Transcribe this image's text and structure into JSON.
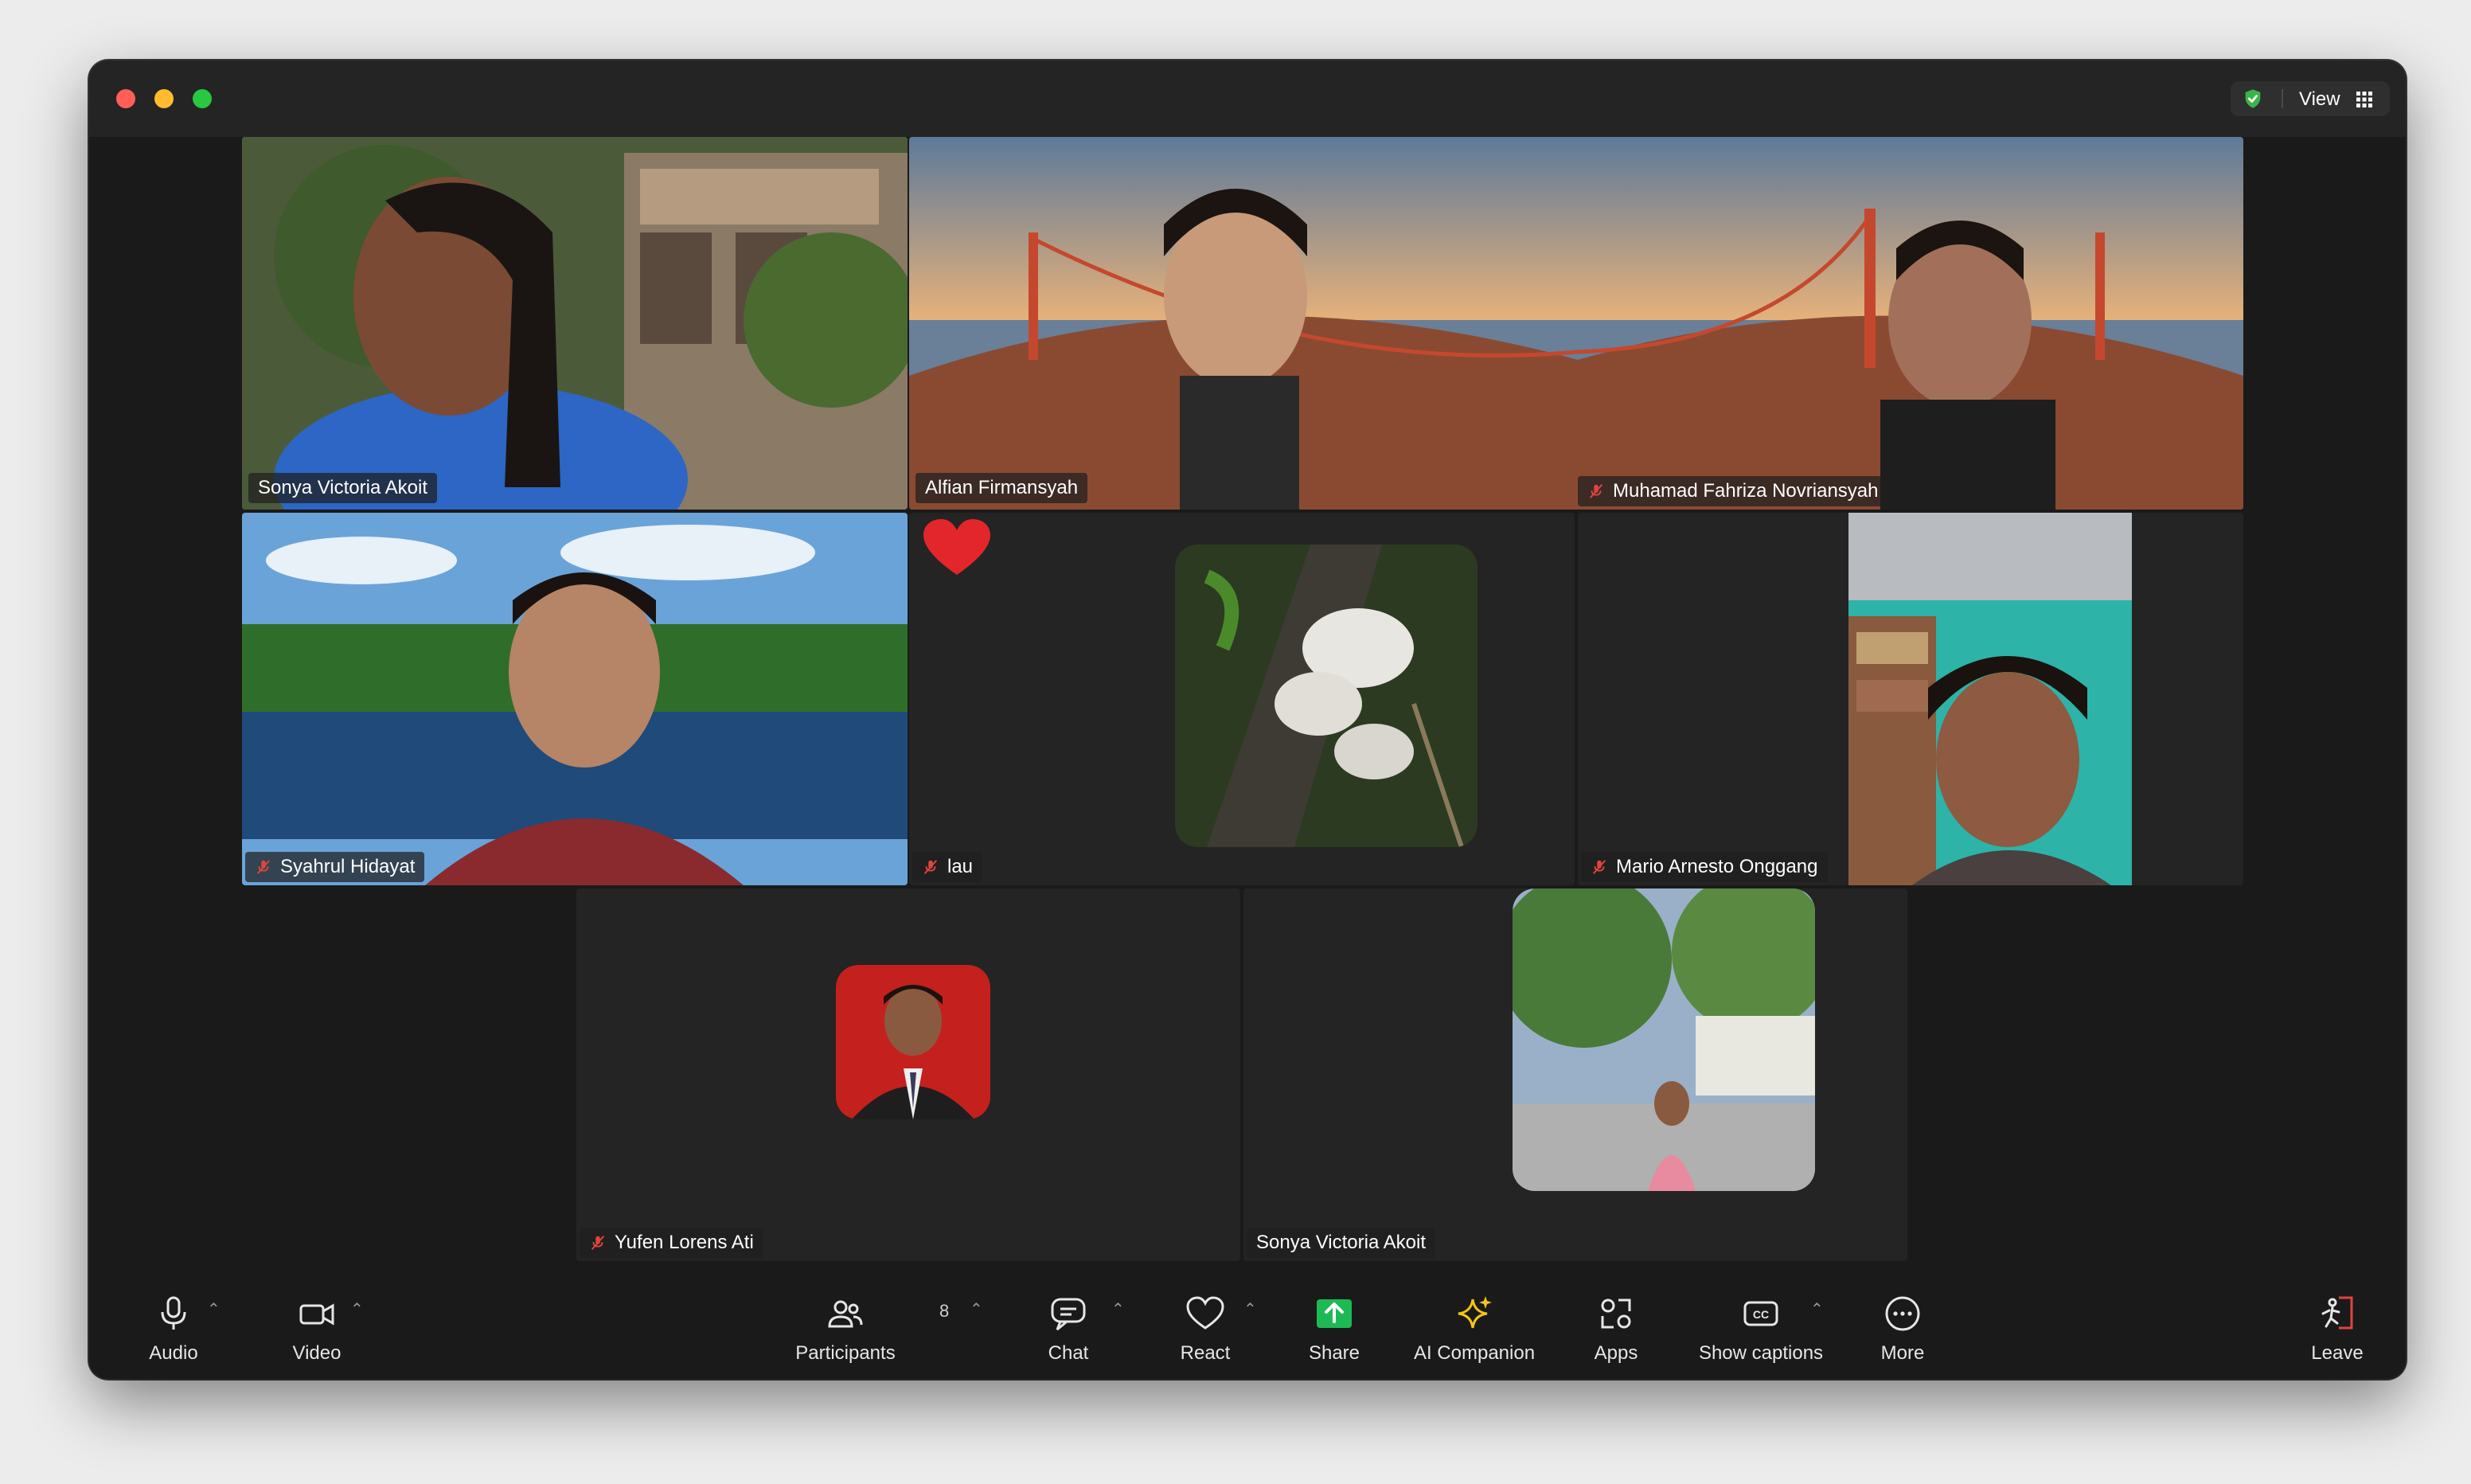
{
  "window": {
    "view_label": "View"
  },
  "participants": {
    "sonya_top": "Sonya Victoria Akoit",
    "alfian": "Alfian Firmansyah",
    "muhamad": "Muhamad Fahriza Novriansyah",
    "syahrul": "Syahrul Hidayat",
    "lau": "lau",
    "mario": "Mario Arnesto Onggang",
    "yufen": "Yufen Lorens Ati",
    "sonya_bottom": "Sonya Victoria Akoit"
  },
  "toolbar": {
    "audio": "Audio",
    "video": "Video",
    "participants": "Participants",
    "participants_count": "8",
    "chat": "Chat",
    "react": "React",
    "share": "Share",
    "ai_companion": "AI Companion",
    "apps": "Apps",
    "show_captions": "Show captions",
    "more": "More",
    "leave": "Leave"
  },
  "colors": {
    "active_speaker": "#5ad15a",
    "share_green": "#1db954",
    "mute_red": "#e0443e",
    "leave_red": "#e0443e",
    "ai_yellow": "#f5c518"
  },
  "icons": {
    "audio": "microphone-icon",
    "video": "camera-icon",
    "participants": "people-icon",
    "chat": "chat-bubble-icon",
    "react": "heart-outline-icon",
    "share": "share-arrow-icon",
    "ai": "sparkle-icon",
    "apps": "apps-icon",
    "captions": "cc-icon",
    "more": "ellipsis-icon",
    "leave": "door-exit-icon"
  }
}
